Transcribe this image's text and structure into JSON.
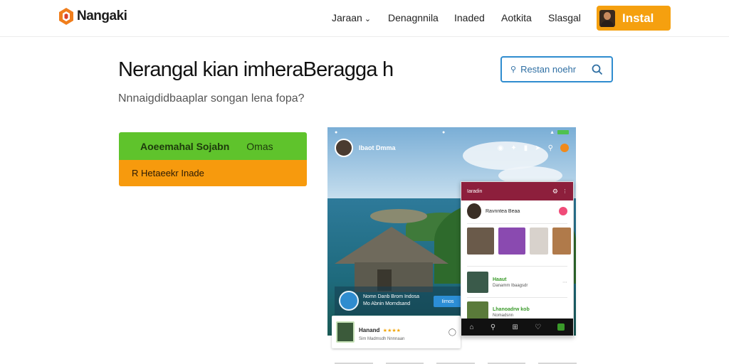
{
  "header": {
    "logo_text": "Nangaki",
    "nav": [
      "Jaraan",
      "Denagnnila",
      "Inaded",
      "Aotkita",
      "Slasgal"
    ],
    "install_label": "Instal"
  },
  "hero": {
    "title": "Nerangal kian imheraBeragga h",
    "subtitle": "Nnnaigdidbaaplar songan lena fopa?",
    "search_label": "Restan noehr",
    "cta_primary": "Aoeemahal",
    "cta_primary_b": "Sojabn",
    "cta_secondary_right": "Omas",
    "cta_orange": "R Hetaeekr Inade"
  },
  "mock": {
    "profile_name": "Ibaot Dmma",
    "post_line1": "Nomn Danb Brom Indosa",
    "post_line2": "Mo Abnin Morndsand",
    "post_button": "Iirnos",
    "card_title": "Hanand",
    "card_stars": "★★★★",
    "card_line": "Sim Madmsdh Nnnnaan"
  },
  "overlay": {
    "header_title": "Iaradin",
    "row1_name": "Ravnntea Beaa",
    "row2_title": "Haaut",
    "row2_line": "Danamm Ibaagsdr",
    "row3_title": "Lhanoadrw kob",
    "row3_line": "Nomadsnn"
  },
  "colors": {
    "install": "#f5a00f",
    "cta_green": "#5fc32c",
    "cta_orange": "#f79a0d",
    "search_border": "#2f8ccf",
    "overlay_header": "#8d1f3c"
  }
}
